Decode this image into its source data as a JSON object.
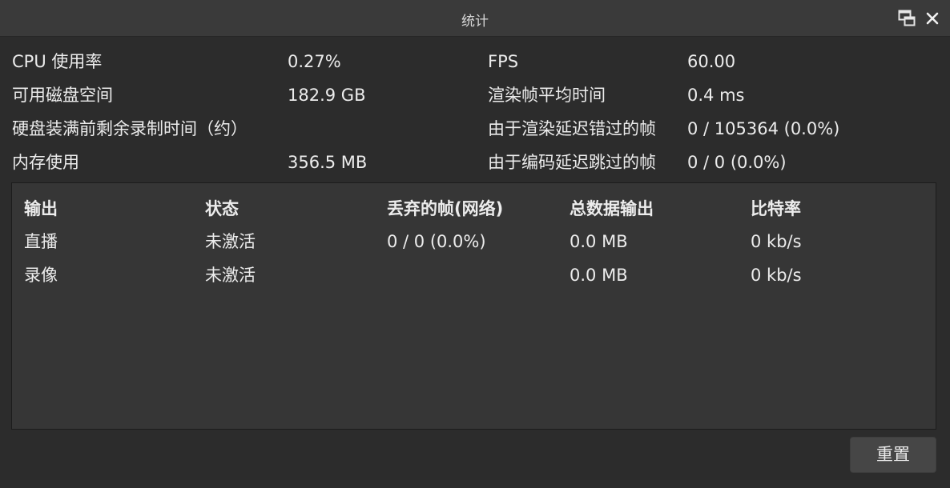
{
  "window": {
    "title": "统计"
  },
  "stats": {
    "left": [
      {
        "label": "CPU 使用率",
        "value": "0.27%"
      },
      {
        "label": "可用磁盘空间",
        "value": "182.9 GB"
      },
      {
        "label": "硬盘装满前剩余录制时间（约）",
        "value": ""
      },
      {
        "label": "内存使用",
        "value": "356.5 MB"
      }
    ],
    "right": [
      {
        "label": "FPS",
        "value": "60.00"
      },
      {
        "label": "渲染帧平均时间",
        "value": "0.4 ms"
      },
      {
        "label": "由于渲染延迟错过的帧",
        "value": "0 / 105364 (0.0%)"
      },
      {
        "label": "由于编码延迟跳过的帧",
        "value": "0 / 0 (0.0%)"
      }
    ]
  },
  "outputs": {
    "headers": [
      "输出",
      "状态",
      "丢弃的帧(网络)",
      "总数据输出",
      "比特率"
    ],
    "rows": [
      [
        "直播",
        "未激活",
        "0 / 0 (0.0%)",
        "0.0 MB",
        "0 kb/s"
      ],
      [
        "录像",
        "未激活",
        "",
        "0.0 MB",
        "0 kb/s"
      ]
    ]
  },
  "buttons": {
    "reset": "重置"
  },
  "icons": {
    "float": "float-window-icon",
    "close": "close-icon"
  },
  "colors": {
    "background": "#2c2c2c",
    "titlebar": "#3a3a3a",
    "table_background": "#363636",
    "text": "#ececec"
  }
}
